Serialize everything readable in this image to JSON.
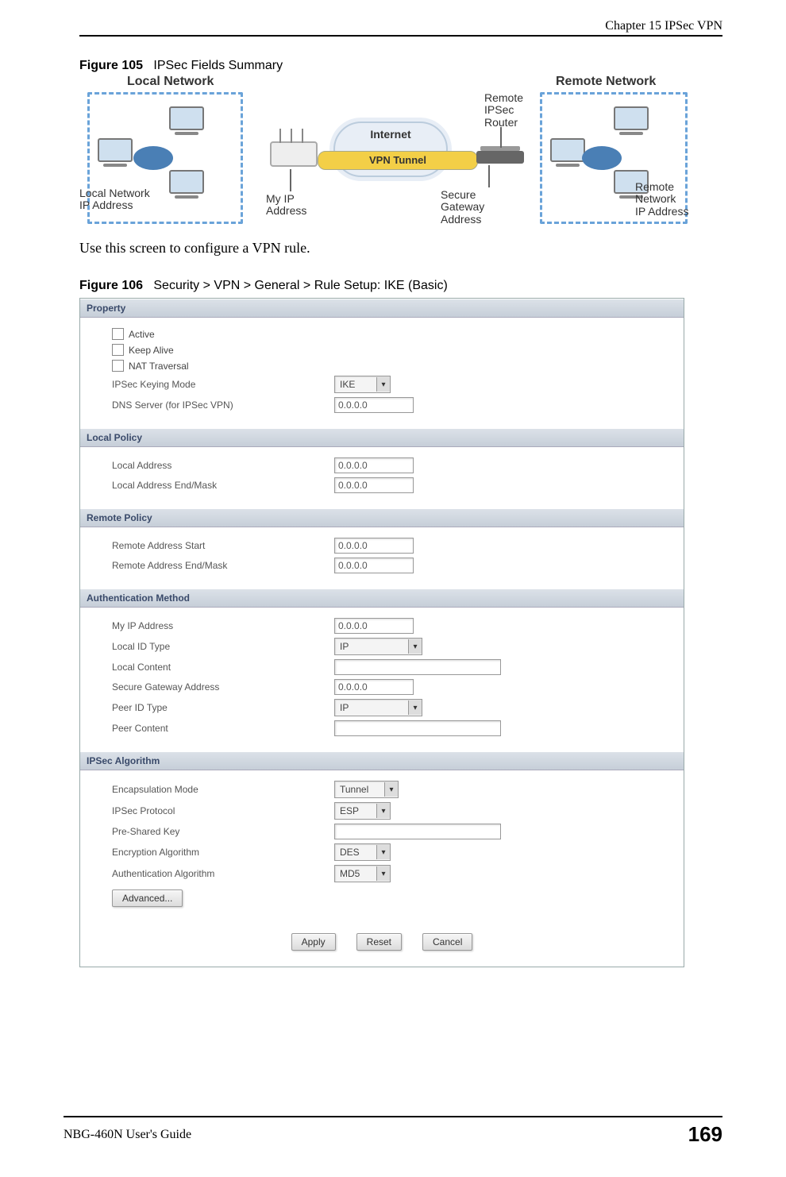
{
  "header": {
    "chapter": "Chapter 15 IPSec VPN"
  },
  "figure105": {
    "caption_prefix": "Figure 105",
    "caption_text": "IPSec Fields Summary",
    "labels": {
      "local_title": "Local Network",
      "remote_title": "Remote Network",
      "local_ip": "Local Network\nIP Address",
      "my_ip": "My IP\nAddress",
      "internet": "Internet",
      "vpn_tunnel": "VPN Tunnel",
      "secure_gw": "Secure\nGateway\nAddress",
      "remote_router": "Remote\nIPSec\nRouter",
      "remote_ip": "Remote\nNetwork\nIP Address"
    }
  },
  "body_text": "Use this screen to configure a VPN rule.",
  "figure106": {
    "caption_prefix": "Figure 106",
    "caption_text": "Security > VPN > General > Rule Setup: IKE (Basic)",
    "sections": {
      "property": {
        "title": "Property",
        "active_label": "Active",
        "keep_alive_label": "Keep Alive",
        "nat_traversal_label": "NAT Traversal",
        "keying_mode_label": "IPSec Keying Mode",
        "keying_mode_value": "IKE",
        "dns_label": "DNS Server (for IPSec VPN)",
        "dns_value": "0.0.0.0"
      },
      "local_policy": {
        "title": "Local Policy",
        "local_addr_label": "Local Address",
        "local_addr_value": "0.0.0.0",
        "local_mask_label": "Local Address End/Mask",
        "local_mask_value": "0.0.0.0"
      },
      "remote_policy": {
        "title": "Remote Policy",
        "remote_start_label": "Remote Address Start",
        "remote_start_value": "0.0.0.0",
        "remote_mask_label": "Remote Address End/Mask",
        "remote_mask_value": "0.0.0.0"
      },
      "auth": {
        "title": "Authentication Method",
        "my_ip_label": "My IP Address",
        "my_ip_value": "0.0.0.0",
        "local_id_type_label": "Local ID Type",
        "local_id_type_value": "IP",
        "local_content_label": "Local Content",
        "local_content_value": "",
        "secure_gw_label": "Secure Gateway Address",
        "secure_gw_value": "0.0.0.0",
        "peer_id_type_label": "Peer ID Type",
        "peer_id_type_value": "IP",
        "peer_content_label": "Peer Content",
        "peer_content_value": ""
      },
      "algo": {
        "title": "IPSec Algorithm",
        "encap_label": "Encapsulation Mode",
        "encap_value": "Tunnel",
        "proto_label": "IPSec Protocol",
        "proto_value": "ESP",
        "psk_label": "Pre-Shared Key",
        "psk_value": "",
        "enc_algo_label": "Encryption Algorithm",
        "enc_algo_value": "DES",
        "auth_algo_label": "Authentication Algorithm",
        "auth_algo_value": "MD5",
        "advanced_btn": "Advanced..."
      }
    },
    "buttons": {
      "apply": "Apply",
      "reset": "Reset",
      "cancel": "Cancel"
    }
  },
  "footer": {
    "guide": "NBG-460N User's Guide",
    "page": "169"
  }
}
